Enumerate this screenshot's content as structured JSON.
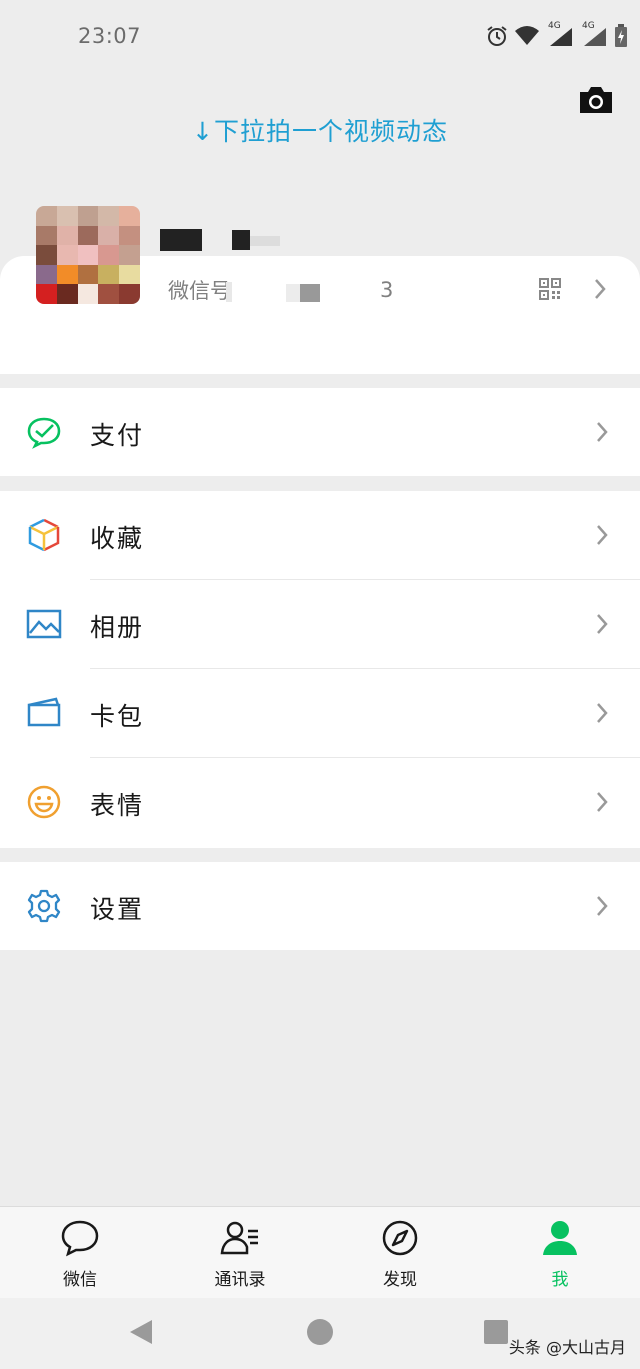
{
  "status_bar": {
    "time": "23:07",
    "network_1": "4G",
    "network_2": "4G",
    "icons": [
      "alarm-icon",
      "wifi-icon",
      "signal-icon",
      "signal-icon",
      "battery-charging-icon"
    ]
  },
  "header": {
    "pull_hint": "↓下拉拍一个视频动态",
    "camera_icon": "camera-icon"
  },
  "profile": {
    "wechat_id_label": "微信号",
    "wechat_id_tail": "3"
  },
  "menu": {
    "pay": {
      "label": "支付",
      "icon": "wechat-pay-icon"
    },
    "favorites": {
      "label": "收藏",
      "icon": "cube-icon"
    },
    "album": {
      "label": "相册",
      "icon": "picture-icon"
    },
    "cards": {
      "label": "卡包",
      "icon": "wallet-icon"
    },
    "stickers": {
      "label": "表情",
      "icon": "smiley-icon"
    },
    "settings": {
      "label": "设置",
      "icon": "gear-icon"
    }
  },
  "tabbar": {
    "chats": "微信",
    "contacts": "通讯录",
    "discover": "发现",
    "me": "我"
  },
  "colors": {
    "accent_green": "#07c160",
    "hint_blue": "#1f9fd2",
    "background": "#ededed"
  },
  "watermark": "头条 @大山古月"
}
